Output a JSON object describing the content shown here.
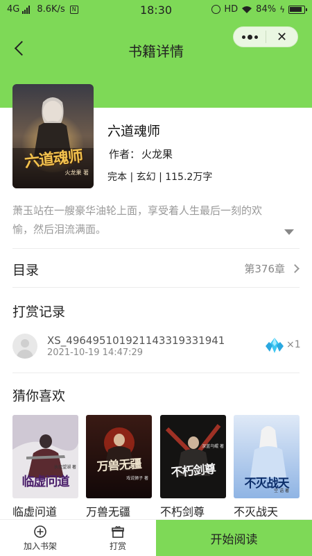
{
  "status_bar": {
    "network": "4G",
    "speed": "8.6K/s",
    "time": "18:30",
    "hd": "HD",
    "battery": "84%"
  },
  "nav": {
    "title": "书籍详情",
    "close_glyph": "✕"
  },
  "book": {
    "title": "六道魂师",
    "author_label": "作者：",
    "author": "火龙果",
    "meta": "完本 | 玄幻 | 115.2万字",
    "cover_text": "六道魂师",
    "cover_author": "火龙果 著",
    "intro": "萧玉站在一艘豪华油轮上面，享受着人生最后一刻的欢愉，然后泪流满面。"
  },
  "toc": {
    "label": "目录",
    "latest": "第376章"
  },
  "reward": {
    "label": "打赏记录",
    "user": "XS_496495101921143319331941",
    "time": "2021-10-19 14:47:29",
    "count": "×1"
  },
  "recommend": {
    "label": "猜你喜欢",
    "items": [
      {
        "title": "临虚问道",
        "cover_text": "临虚问道",
        "cover_author": "执砚望湖 著"
      },
      {
        "title": "万兽无疆",
        "cover_text": "万兽无疆",
        "cover_author": "戏说狮子 著"
      },
      {
        "title": "不朽剑尊",
        "cover_text": "不朽剑尊",
        "cover_author": "深蓝乌鲲 著"
      },
      {
        "title": "不灭战天",
        "cover_text": "不灭战天",
        "cover_author": "空 语 著"
      }
    ]
  },
  "bottom": {
    "add_shelf": "加入书架",
    "reward": "打赏",
    "start_reading": "开始阅读"
  },
  "colors": {
    "accent": "#7ed957"
  }
}
